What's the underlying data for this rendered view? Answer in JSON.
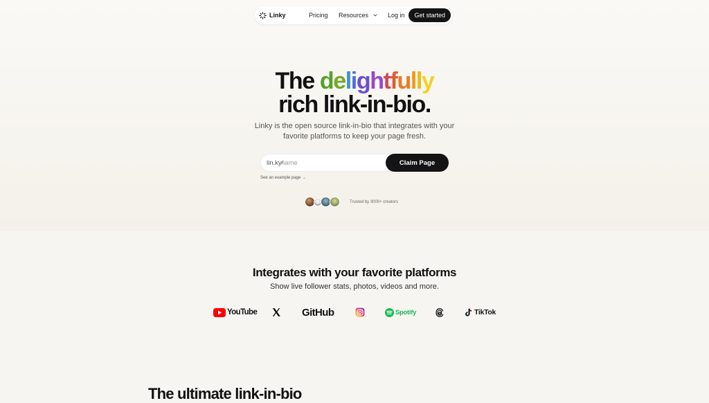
{
  "nav": {
    "brand": "Linky",
    "pricing": "Pricing",
    "resources": "Resources",
    "login": "Log in",
    "get_started": "Get started"
  },
  "hero": {
    "title_before": "The",
    "title_rainbow": [
      "d",
      "e",
      "l",
      "i",
      "g",
      "h",
      "t",
      "f",
      "u",
      "l",
      "l",
      "y"
    ],
    "rainbow_colors": [
      "#5aa02c",
      "#74a92c",
      "#3f8fd6",
      "#4a6fd8",
      "#6a4fd0",
      "#9a48c6",
      "#d04a5a",
      "#e05b34",
      "#ea7a22",
      "#ef9a1c",
      "#f0b81a",
      "#f3d12a"
    ],
    "title_line2": "rich link-in-bio.",
    "subtitle_line1": "Linky is the open source link-in-bio that integrates with your",
    "subtitle_line2": "favorite platforms to keep your page fresh.",
    "input_prefix": "lin.ky/",
    "input_placeholder": "name",
    "claim_button": "Claim Page",
    "example_link": "See an example page →",
    "trusted": "Trusted by 3000+ creators"
  },
  "integrations": {
    "title": "Integrates with your favorite platforms",
    "subtitle": "Show live follower stats, photos, videos and more.",
    "youtube": "YouTube",
    "github": "GitHub",
    "spotify": "Spotify",
    "tiktok": "TikTok"
  },
  "next_section": {
    "title": "The ultimate link-in-bio"
  },
  "colors": {
    "dark_button": "#141414",
    "youtube_red": "#ff0000",
    "spotify_green": "#1db954"
  }
}
